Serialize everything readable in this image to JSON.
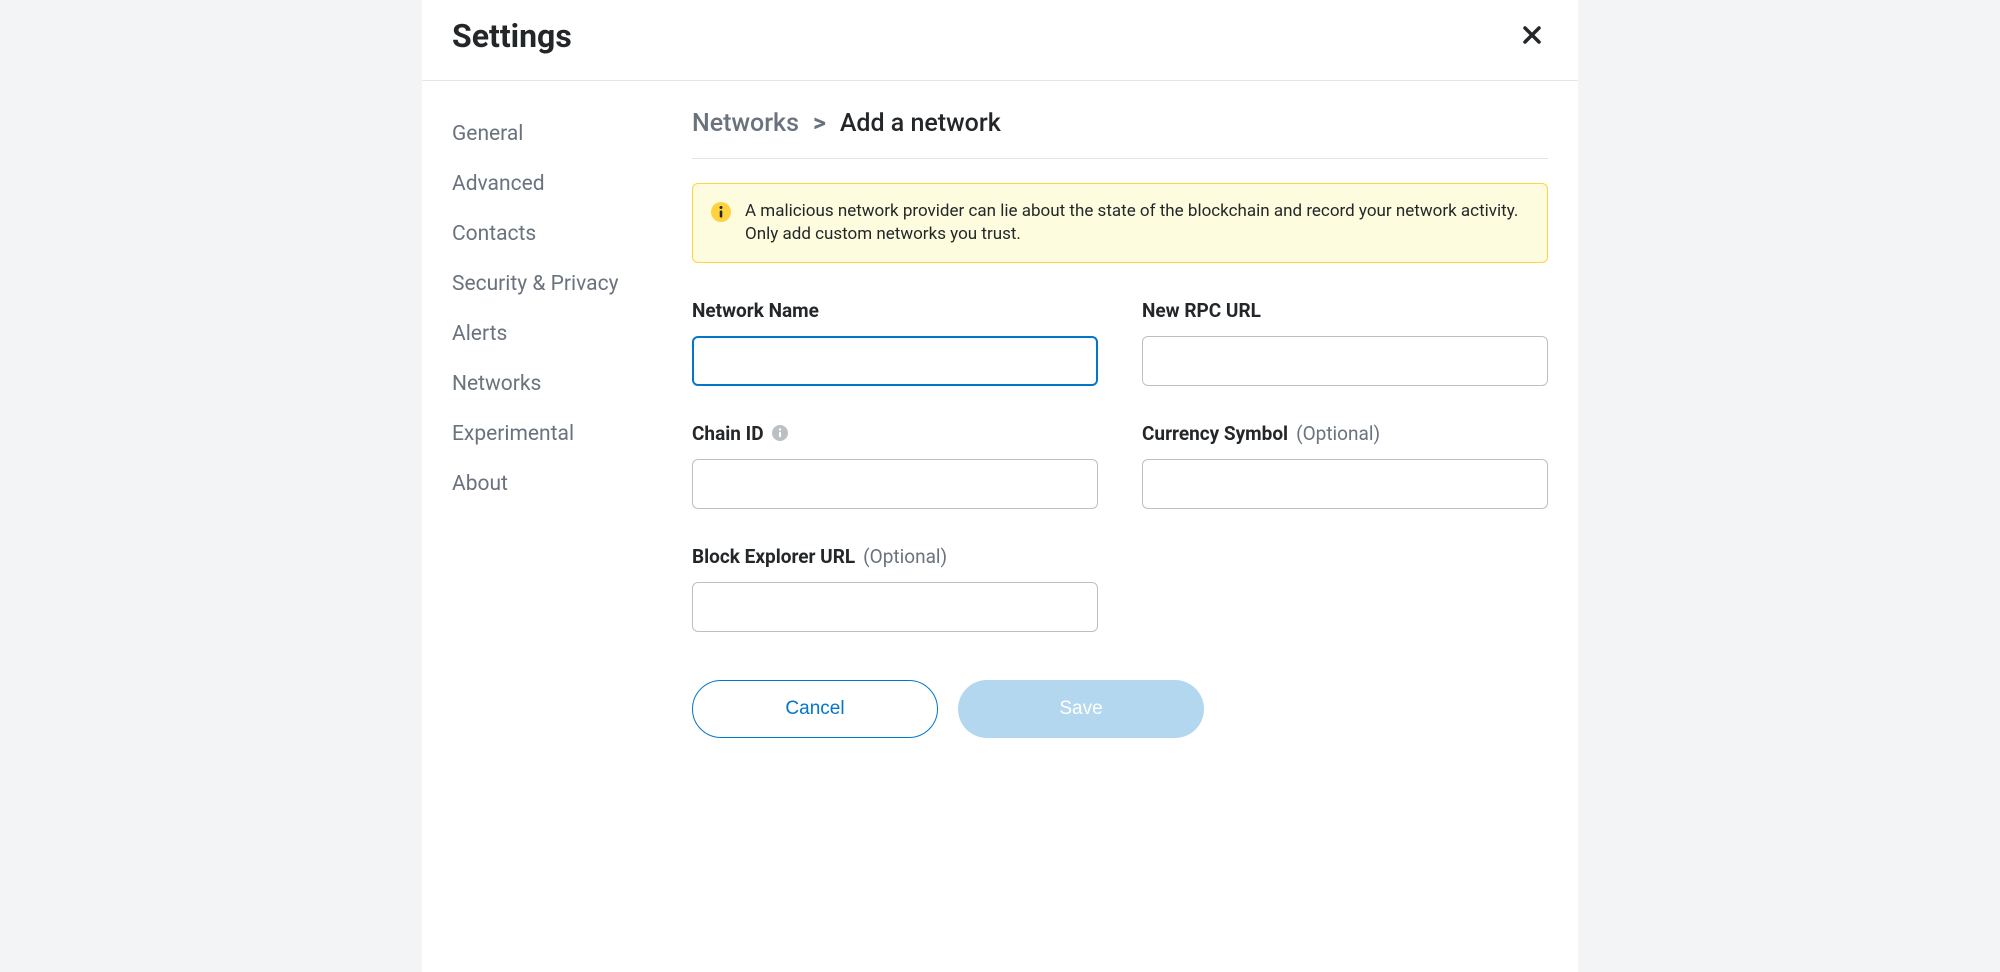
{
  "header": {
    "title": "Settings"
  },
  "sidebar": {
    "items": [
      {
        "label": "General"
      },
      {
        "label": "Advanced"
      },
      {
        "label": "Contacts"
      },
      {
        "label": "Security & Privacy"
      },
      {
        "label": "Alerts"
      },
      {
        "label": "Networks"
      },
      {
        "label": "Experimental"
      },
      {
        "label": "About"
      }
    ]
  },
  "breadcrumb": {
    "prev": "Networks",
    "sep": ">",
    "current": "Add a network"
  },
  "warning": {
    "text": "A malicious network provider can lie about the state of the blockchain and record your network activity. Only add custom networks you trust."
  },
  "form": {
    "network_name": {
      "label": "Network Name",
      "value": ""
    },
    "rpc_url": {
      "label": "New RPC URL",
      "value": ""
    },
    "chain_id": {
      "label": "Chain ID",
      "value": ""
    },
    "currency_symbol": {
      "label": "Currency Symbol",
      "optional": "(Optional)",
      "value": ""
    },
    "block_explorer": {
      "label": "Block Explorer URL",
      "optional": "(Optional)",
      "value": ""
    }
  },
  "buttons": {
    "cancel": "Cancel",
    "save": "Save"
  }
}
